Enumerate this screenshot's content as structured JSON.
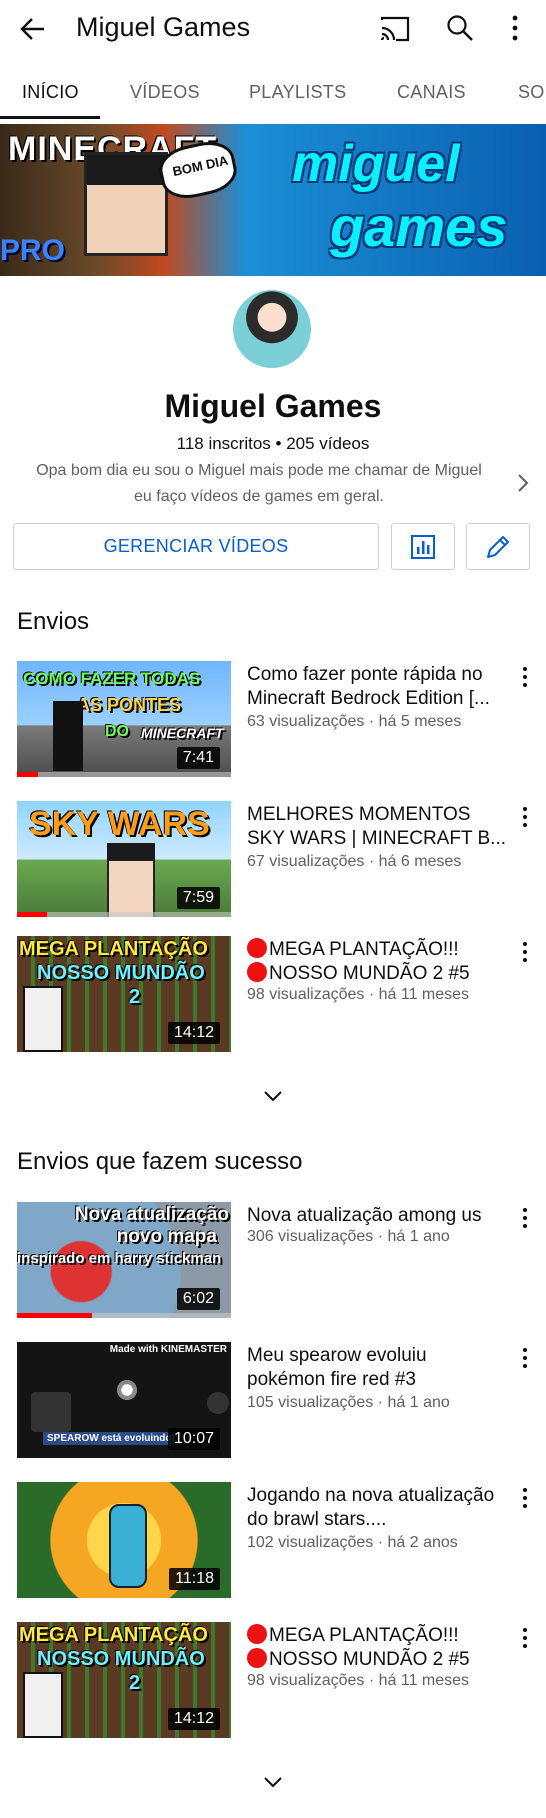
{
  "appbar": {
    "title": "Miguel Games",
    "icons": [
      "back-arrow-icon",
      "cast-icon",
      "search-icon",
      "more-vert-icon"
    ]
  },
  "tabs": [
    {
      "label": "INÍCIO",
      "active": true
    },
    {
      "label": "VÍDEOS",
      "active": false
    },
    {
      "label": "PLAYLISTS",
      "active": false
    },
    {
      "label": "CANAIS",
      "active": false
    },
    {
      "label": "SOBRE",
      "active": false
    }
  ],
  "banner": {
    "text_left": "MINECRAFT",
    "speech": "BOM DIA",
    "pro": "PRO",
    "word1": "miguel",
    "word2": "games"
  },
  "channel": {
    "name": "Miguel Games",
    "subscribers": "118 inscritos",
    "videos_count": "205 vídeos",
    "meta": "118 inscritos • 205 vídeos",
    "description": "Opa bom dia eu sou o Miguel mais pode me chamar de Miguel eu faço vídeos de games em geral."
  },
  "actions": {
    "manage_label": "GERENCIAR VÍDEOS",
    "analytics_icon": "analytics-icon",
    "edit_icon": "edit-pencil-icon"
  },
  "sections": {
    "uploads_title": "Envios",
    "popular_title": "Envios que fazem sucesso"
  },
  "uploads": [
    {
      "title": "Como fazer ponte rápida no Minecraft Bedrock Edition [...",
      "meta": "63 visualizações · há 5 meses",
      "duration": "7:41",
      "progress": 0.1,
      "thumb_text": [
        "COMO FAZER TODAS",
        "AS PONTES",
        "DO",
        "MINECRAFT"
      ]
    },
    {
      "title": "MELHORES MOMENTOS SKY WARS | MINECRAFT B...",
      "meta": "67 visualizações · há 6 meses",
      "duration": "7:59",
      "progress": 0.14,
      "thumb_text": [
        "SKY WARS"
      ]
    },
    {
      "title": "MEGA PLANTAÇÃO!!! NOSSO MUNDÃO 2 #5",
      "title_line1": "MEGA PLANTAÇÃO!!!",
      "title_line2": "NOSSO MUNDÃO 2 #5",
      "meta": "98 visualizações · há 11 meses",
      "duration": "14:12",
      "progress": 0,
      "thumb_text": [
        "MEGA PLANTAÇÃO",
        "NOSSO MUNDÃO",
        "2"
      ]
    }
  ],
  "popular": [
    {
      "title": "Nova atualização among us",
      "meta": "306 visualizações · há 1 ano",
      "duration": "6:02",
      "progress": 0.35,
      "thumb_text": [
        "Nova atualização",
        "novo mapa",
        "inspirado em harry stickman"
      ]
    },
    {
      "title": "Meu spearow evoluiu pokémon fire red #3",
      "meta": "105 visualizações · há 1 ano",
      "duration": "10:07",
      "progress": 0,
      "thumb_text": [
        "Made with KINEMASTER",
        "SPEAROW está evoluindo!"
      ]
    },
    {
      "title": "Jogando na nova atualização do brawl stars....",
      "meta": "102 visualizações · há 2 anos",
      "duration": "11:18",
      "progress": 0,
      "thumb_text": []
    },
    {
      "title": "MEGA PLANTAÇÃO!!! NOSSO MUNDÃO 2 #5",
      "title_line1": "MEGA PLANTAÇÃO!!!",
      "title_line2": "NOSSO MUNDÃO 2 #5",
      "meta": "98 visualizações · há 11 meses",
      "duration": "14:12",
      "progress": 0,
      "thumb_text": [
        "MEGA PLANTAÇÃO",
        "NOSSO MUNDÃO",
        "2"
      ]
    }
  ]
}
